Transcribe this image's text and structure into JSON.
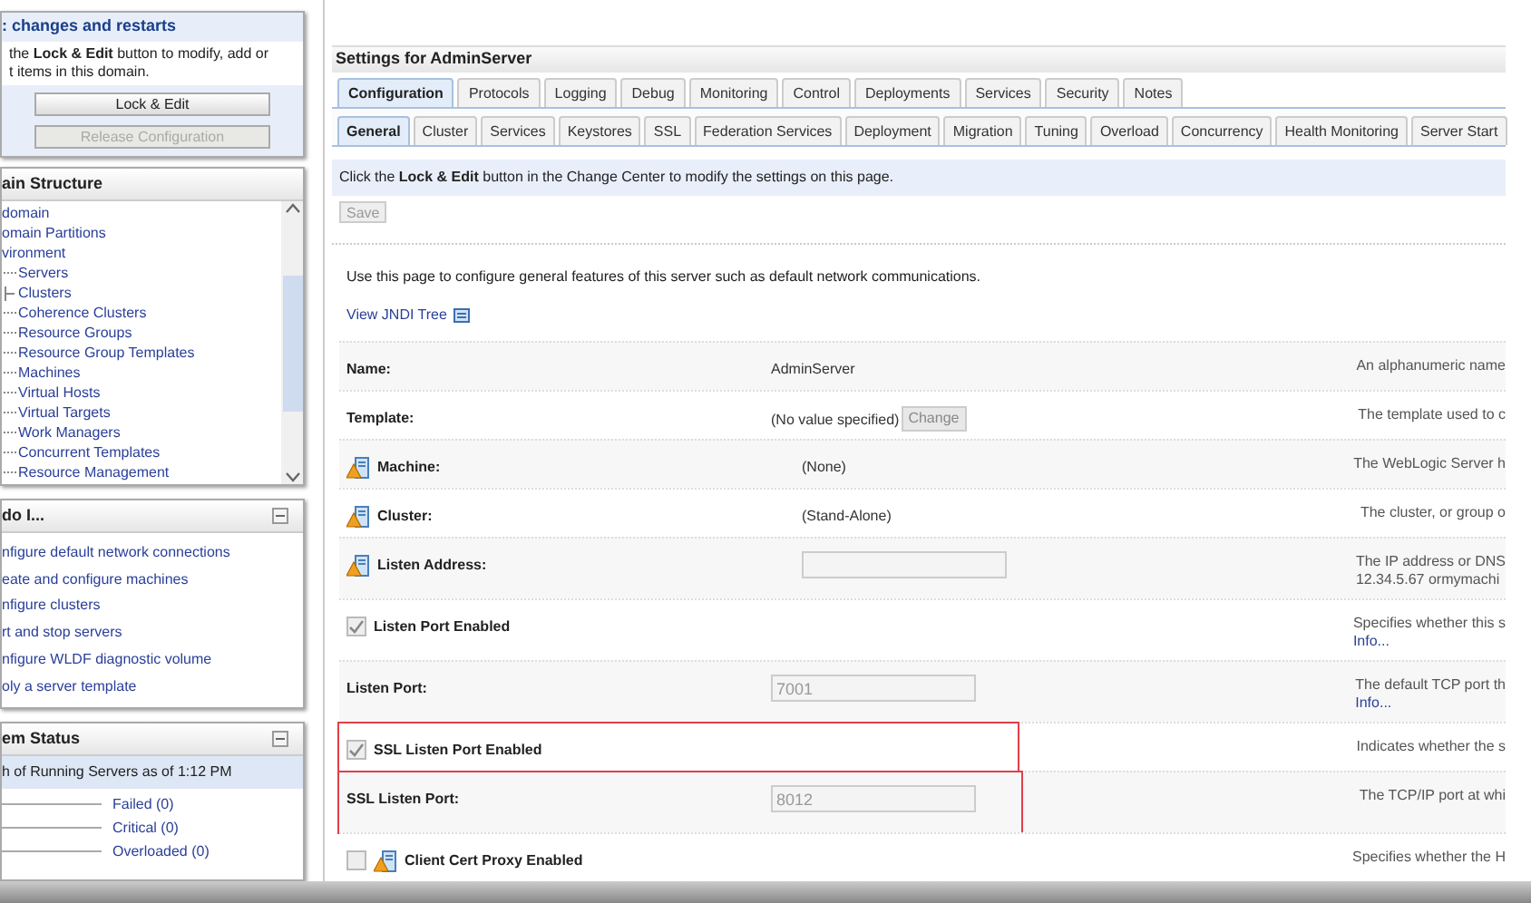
{
  "change_center": {
    "title": ": changes and restarts",
    "text": "the **Lock & Edit** button to modify, add or",
    "text2": "t items in this domain.",
    "buttons": [
      {
        "label": "Lock & Edit",
        "disabled": false
      },
      {
        "label": "Release Configuration",
        "disabled": true
      }
    ]
  },
  "domain_structure": {
    "title": "ain Structure",
    "items": [
      {
        "label": "domain"
      },
      {
        "label": "omain Partitions"
      },
      {
        "label": "vironment",
        "children": [
          {
            "label": "Servers"
          },
          {
            "label": "Clusters",
            "expandable": true
          },
          {
            "label": "Coherence Clusters"
          },
          {
            "label": "Resource Groups"
          },
          {
            "label": "Resource Group Templates"
          },
          {
            "label": "Machines"
          },
          {
            "label": "Virtual Hosts"
          },
          {
            "label": "Virtual Targets"
          },
          {
            "label": "Work Managers"
          },
          {
            "label": "Concurrent Templates"
          },
          {
            "label": "Resource Management"
          }
        ]
      }
    ]
  },
  "how_do_i": {
    "title": "do I...",
    "links": [
      "nfigure default network connections",
      "eate and configure machines",
      "nfigure clusters",
      "rt and stop servers",
      "nfigure WLDF diagnostic volume",
      "oly a server template"
    ]
  },
  "system_status": {
    "title": "em Status",
    "subtitle": "h of Running Servers as of  1:12 PM",
    "items": [
      "Failed (0)",
      "Critical (0)",
      "Overloaded (0)"
    ]
  },
  "settings": {
    "title": "Settings for AdminServer",
    "tabs": [
      {
        "label": "Configuration",
        "selected": true
      },
      {
        "label": "Protocols",
        "selected": false
      },
      {
        "label": "Logging",
        "selected": false
      },
      {
        "label": "Debug",
        "selected": false
      },
      {
        "label": "Monitoring",
        "selected": false
      },
      {
        "label": "Control",
        "selected": false
      },
      {
        "label": "Deployments",
        "selected": false
      },
      {
        "label": "Services",
        "selected": false
      },
      {
        "label": "Security",
        "selected": false
      },
      {
        "label": "Notes",
        "selected": false
      }
    ],
    "subtabs": [
      {
        "label": "General",
        "selected": true
      },
      {
        "label": "Cluster",
        "selected": false
      },
      {
        "label": "Services",
        "selected": false
      },
      {
        "label": "Keystores",
        "selected": false
      },
      {
        "label": "SSL",
        "selected": false
      },
      {
        "label": "Federation Services",
        "selected": false
      },
      {
        "label": "Deployment",
        "selected": false
      },
      {
        "label": "Migration",
        "selected": false
      },
      {
        "label": "Tuning",
        "selected": false
      },
      {
        "label": "Overload",
        "selected": false
      },
      {
        "label": "Concurrency",
        "selected": false
      },
      {
        "label": "Health Monitoring",
        "selected": false
      },
      {
        "label": "Server Start",
        "selected": false
      }
    ],
    "notice": "Click the **Lock & Edit** button in the Change Center to modify the settings on this page.",
    "save_button": {
      "label": "Save",
      "disabled": true
    },
    "intro": "Use this page to configure general features of this server such as default network communications.",
    "jndi_link": "View JNDI Tree",
    "rows": [
      {
        "kind": "text",
        "label": "Name:",
        "warning": false,
        "value": "AdminServer",
        "description": [
          "An alphanumeric name"
        ],
        "highlighted": false
      },
      {
        "kind": "text",
        "label": "Template:",
        "warning": false,
        "value": "(No value specified)",
        "button": "Change",
        "description": [
          "The template used to c"
        ],
        "highlighted": false
      },
      {
        "kind": "text",
        "label": "Machine:",
        "warning": true,
        "value": "(None)",
        "description": [
          "The WebLogic Server h"
        ],
        "highlighted": false
      },
      {
        "kind": "text",
        "label": "Cluster:",
        "warning": true,
        "value": "(Stand-Alone)",
        "description": [
          "The cluster, or group o"
        ],
        "highlighted": false
      },
      {
        "kind": "input",
        "label": "Listen Address:",
        "warning": true,
        "value": "",
        "description": [
          "The IP address or DNS",
          "12.34.5.67 ormymachi"
        ],
        "highlighted": false
      },
      {
        "kind": "checkbox",
        "label": "Listen Port Enabled",
        "warning": false,
        "checked": true,
        "description": [
          "Specifies whether this s"
        ],
        "info": "Info...",
        "highlighted": false
      },
      {
        "kind": "input",
        "label": "Listen Port:",
        "warning": false,
        "value": "7001",
        "description": [
          "The default TCP port th"
        ],
        "info": "Info...",
        "highlighted": false
      },
      {
        "kind": "checkbox",
        "label": "SSL Listen Port Enabled",
        "warning": false,
        "checked": true,
        "description": [
          "Indicates whether the s"
        ],
        "highlighted": true
      },
      {
        "kind": "input",
        "label": "SSL Listen Port:",
        "warning": false,
        "value": "8012",
        "description": [
          "The TCP/IP port at whi"
        ],
        "highlighted": true
      },
      {
        "kind": "checkbox",
        "label": "Client Cert Proxy Enabled",
        "warning": true,
        "checked": false,
        "description": [
          "Specifies whether the H"
        ],
        "highlighted": false
      }
    ]
  }
}
